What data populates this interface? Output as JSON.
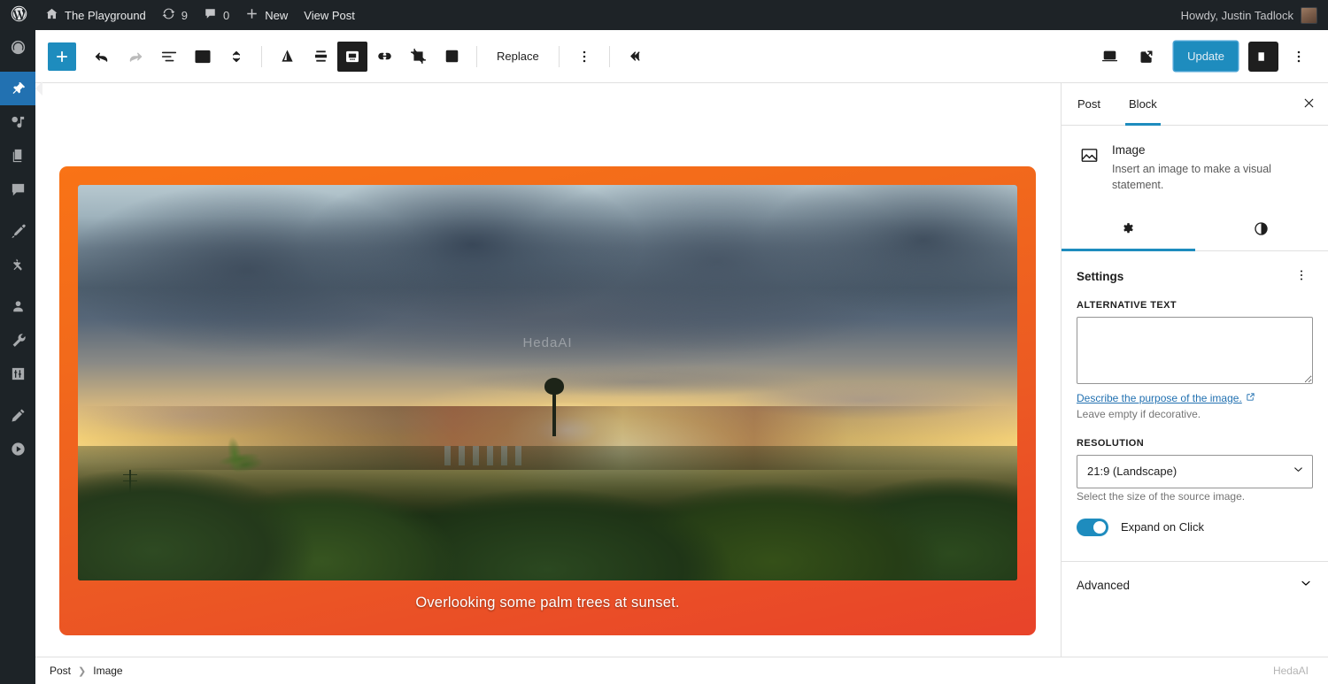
{
  "adminbar": {
    "logo_icon": "wordpress-logo-icon",
    "site_icon": "home-icon",
    "site_name": "The Playground",
    "revisions_icon": "updates-icon",
    "revisions_count": "9",
    "comments_icon": "comment-bubble-icon",
    "comments_count": "0",
    "new_icon": "plus-icon",
    "new_label": "New",
    "view_post_label": "View Post",
    "howdy": "Howdy, Justin Tadlock"
  },
  "adminmenu": {
    "items": [
      {
        "name": "dashboard",
        "icon": "dashboard-icon"
      },
      {
        "name": "posts",
        "icon": "pin-icon",
        "current": true
      },
      {
        "name": "media",
        "icon": "media-icon"
      },
      {
        "name": "pages",
        "icon": "pages-icon"
      },
      {
        "name": "comments",
        "icon": "comment-icon"
      },
      {
        "name": "appearance",
        "icon": "paintbrush-icon"
      },
      {
        "name": "plugins",
        "icon": "plugins-icon"
      },
      {
        "name": "users",
        "icon": "user-icon"
      },
      {
        "name": "tools",
        "icon": "wrench-icon"
      },
      {
        "name": "settings",
        "icon": "settings-sliders-icon"
      },
      {
        "name": "editor",
        "icon": "pencil-icon"
      },
      {
        "name": "player",
        "icon": "play-circle-icon"
      }
    ]
  },
  "toolbar": {
    "inserter_icon": "plus-icon",
    "undo_icon": "undo-arrow-icon",
    "redo_icon": "redo-arrow-icon",
    "list_view_icon": "document-outline-icon",
    "block_type_icon": "image-icon",
    "move_icon": "up-down-chevrons-icon",
    "align_icon": "align-triangle-icon",
    "vertical_align_icon": "vertical-align-icon",
    "caption_position_icon": "caption-position-icon",
    "link_icon": "link-icon",
    "crop_icon": "crop-icon",
    "text_overlay_icon": "add-text-over-image-icon",
    "replace_label": "Replace",
    "options_icon": "three-dots-vertical-icon",
    "collapse_icon": "double-chevron-left-icon",
    "preview_icon": "desktop-preview-icon",
    "view_icon": "external-link-icon",
    "update_label": "Update",
    "sidebar_toggle_icon": "sidebar-panel-icon",
    "more_icon": "three-dots-vertical-icon"
  },
  "canvas": {
    "image_alt_overlay": "HedaAI",
    "caption": "Overlooking some palm trees at sunset.",
    "border_color": "#f97316",
    "border_color_end": "#e8432a"
  },
  "sidebar": {
    "tabs": [
      {
        "label": "Post",
        "active": false
      },
      {
        "label": "Block",
        "active": true
      }
    ],
    "close_icon": "close-x-icon",
    "block": {
      "icon": "image-icon",
      "title": "Image",
      "description": "Insert an image to make a visual statement."
    },
    "subtabs": [
      {
        "name": "settings",
        "icon": "gear-icon",
        "active": true
      },
      {
        "name": "styles",
        "icon": "contrast-half-circle-icon",
        "active": false
      }
    ],
    "settings": {
      "title": "Settings",
      "more_icon": "three-dots-vertical-icon",
      "alt_text_label": "Alternative text",
      "alt_text_value": "",
      "alt_help_link": "Describe the purpose of the image.",
      "alt_help_link_icon": "external-link-icon",
      "alt_help_text": "Leave empty if decorative.",
      "resolution_label": "Resolution",
      "resolution_value": "21:9 (Landscape)",
      "resolution_chevron_icon": "chevron-down-icon",
      "resolution_help": "Select the size of the source image.",
      "expand_toggle_label": "Expand on Click",
      "expand_toggle_on": true
    },
    "advanced_label": "Advanced",
    "advanced_chevron_icon": "chevron-down-icon"
  },
  "breadcrumbs": {
    "items": [
      "Post",
      "Image"
    ],
    "separator_icon": "chevron-right-icon",
    "watermark": "HedaAI"
  },
  "colors": {
    "accent": "#1e8cbe",
    "admin_dark": "#1d2327"
  }
}
